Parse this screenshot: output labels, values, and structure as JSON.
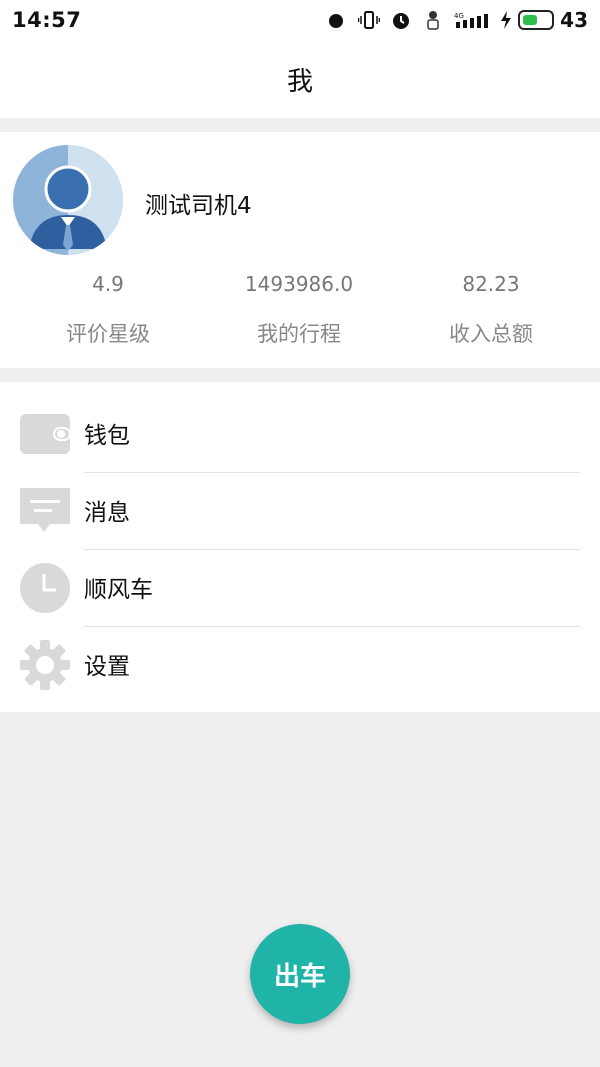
{
  "statusbar": {
    "time": "14:57",
    "network": "4G",
    "battery_level": "43"
  },
  "header": {
    "title": "我"
  },
  "profile": {
    "name": "测试司机4",
    "stats": [
      {
        "value": "4.9",
        "label": "评价星级"
      },
      {
        "value": "1493986.0",
        "label": "我的行程"
      },
      {
        "value": "82.23",
        "label": "收入总额"
      }
    ]
  },
  "menu": {
    "items": [
      {
        "label": "钱包",
        "icon": "wallet-icon"
      },
      {
        "label": "消息",
        "icon": "message-icon"
      },
      {
        "label": "顺风车",
        "icon": "clock-icon"
      },
      {
        "label": "设置",
        "icon": "gear-icon"
      }
    ]
  },
  "fab": {
    "label": "出车"
  },
  "colors": {
    "accent": "#20b3a8",
    "battery": "#2cc04b",
    "icon_gray": "#d9d9d9",
    "background": "#efefef"
  }
}
